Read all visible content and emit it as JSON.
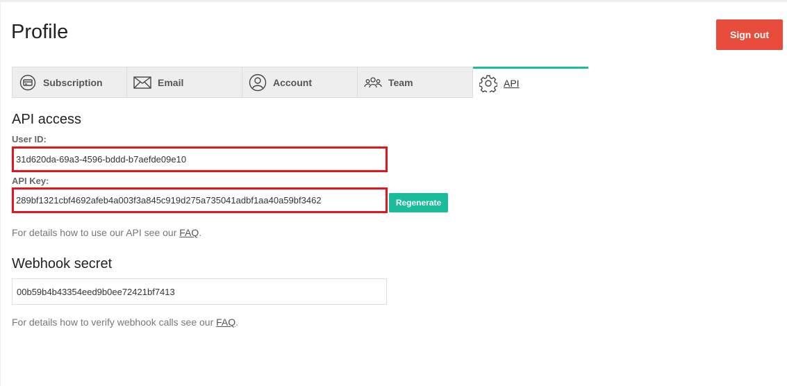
{
  "header": {
    "title": "Profile",
    "signout_label": "Sign out"
  },
  "tabs": [
    {
      "label": "Subscription",
      "icon": "card-icon",
      "active": false
    },
    {
      "label": "Email",
      "icon": "envelope-icon",
      "active": false
    },
    {
      "label": "Account",
      "icon": "user-icon",
      "active": false
    },
    {
      "label": "Team",
      "icon": "team-icon",
      "active": false
    },
    {
      "label": "API",
      "icon": "gear-icon",
      "active": true
    }
  ],
  "api": {
    "heading": "API access",
    "user_id_label": "User ID:",
    "user_id_value": "31d620da-69a3-4596-bddd-b7aefde09e10",
    "api_key_label": "API Key:",
    "api_key_value": "289bf1321cbf4692afeb4a003f3a845c919d275a735041adbf1aa40a59bf3462",
    "regenerate_label": "Regenerate",
    "note_prefix": "For details how to use our API see our ",
    "note_link": "FAQ",
    "note_suffix": "."
  },
  "webhook": {
    "heading": "Webhook secret",
    "secret_value": "00b59b4b43354eed9b0ee72421bf7413",
    "note_prefix": "For details how to verify webhook calls see our ",
    "note_link": "FAQ",
    "note_suffix": "."
  },
  "colors": {
    "signout": "#e74c3c",
    "accent": "#1abc9c",
    "highlight": "#e8141b"
  }
}
